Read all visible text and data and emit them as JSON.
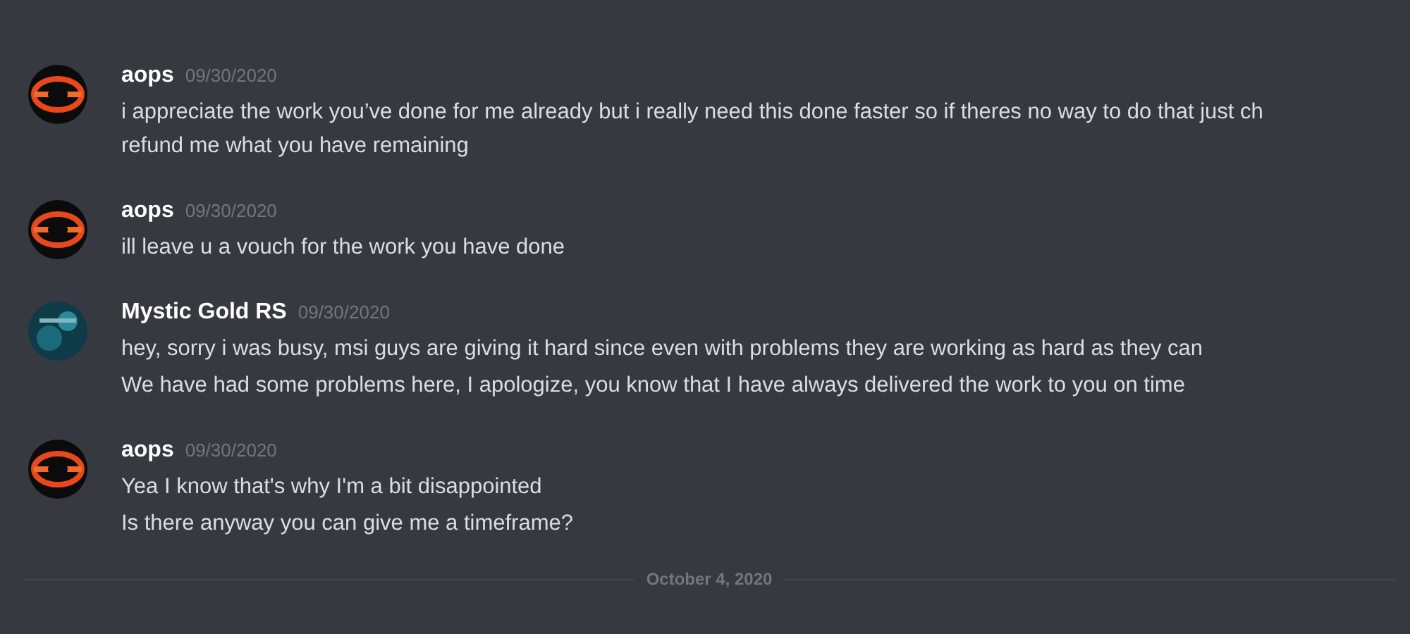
{
  "messages": [
    {
      "author": "aops",
      "kind": "ring",
      "timestamp": "09/30/2020",
      "lines": [
        [
          "i appreciate the work you’ve done for me already but i really need this done faster so if theres no way to do that just ch",
          "refund me what you have remaining"
        ]
      ]
    },
    {
      "author": "aops",
      "kind": "ring",
      "timestamp": "09/30/2020",
      "lines": [
        [
          "ill leave u a vouch for the work you have done"
        ]
      ]
    },
    {
      "author": "Mystic Gold RS",
      "kind": "teal",
      "timestamp": "09/30/2020",
      "lines": [
        [
          "hey, sorry i was busy, msi guys are giving it hard since even with problems they are working as hard as they can"
        ],
        [
          "We have had some problems here, I apologize, you know that I have always delivered the work to you on time"
        ]
      ]
    },
    {
      "author": "aops",
      "kind": "ring",
      "timestamp": "09/30/2020",
      "lines": [
        [
          "Yea I know that's why I'm a bit disappointed"
        ],
        [
          "Is there anyway you can give me a timeframe?"
        ]
      ]
    }
  ],
  "date_divider": "October 4, 2020"
}
